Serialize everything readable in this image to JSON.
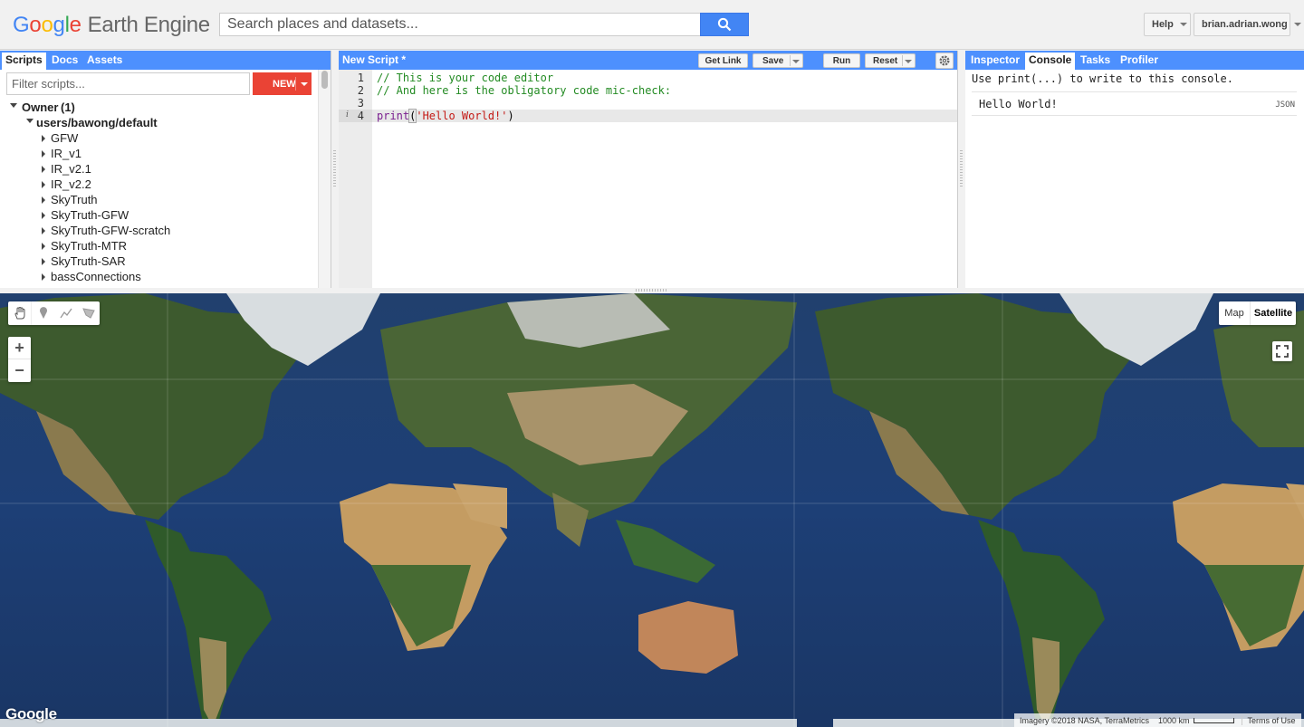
{
  "header": {
    "logo_google": [
      "G",
      "o",
      "o",
      "g",
      "l",
      "e"
    ],
    "logo_product": "Earth Engine",
    "search_placeholder": "Search places and datasets...",
    "help_label": "Help",
    "user_label": "brian.adrian.wong"
  },
  "left_panel": {
    "tabs": [
      "Scripts",
      "Docs",
      "Assets"
    ],
    "filter_placeholder": "Filter scripts...",
    "new_label": "NEW",
    "owner_label": "Owner",
    "owner_count": "(1)",
    "repo": "users/bawong/default",
    "scripts": [
      "GFW",
      "IR_v1",
      "IR_v2.1",
      "IR_v2.2",
      "SkyTruth",
      "SkyTruth-GFW",
      "SkyTruth-GFW-scratch",
      "SkyTruth-MTR",
      "SkyTruth-SAR",
      "bassConnections"
    ]
  },
  "editor": {
    "title": "New Script *",
    "get_link_label": "Get Link",
    "save_label": "Save",
    "run_label": "Run",
    "reset_label": "Reset",
    "line_numbers": [
      "1",
      "2",
      "3",
      "4"
    ],
    "line1": "// This is your code editor",
    "line2": "// And here is the obligatory code mic-check:",
    "line4_fn": "print",
    "line4_open": "(",
    "line4_str": "'Hello World!'",
    "line4_close": ")",
    "info_marker": "i"
  },
  "right_panel": {
    "tabs": [
      "Inspector",
      "Console",
      "Tasks",
      "Profiler"
    ],
    "active_tab": "Console",
    "console_message": "Use print(...) to write to this console.",
    "console_output": "Hello World!",
    "json_label": "JSON"
  },
  "map": {
    "map_type_options": [
      "Map",
      "Satellite"
    ],
    "selected_map_type": "Satellite",
    "zoom_in": "+",
    "zoom_out": "−",
    "google_logo": "Google",
    "imagery_credit": "Imagery ©2018 NASA, TerraMetrics",
    "scale_label": "1000 km",
    "terms_label": "Terms of Use",
    "drawing_tools": [
      "hand-icon",
      "point-icon",
      "line-icon",
      "polygon-icon"
    ]
  },
  "colors": {
    "accent_blue": "#4d90fe",
    "new_button_red": "#ea4335",
    "ocean": "#1a3a6b"
  }
}
